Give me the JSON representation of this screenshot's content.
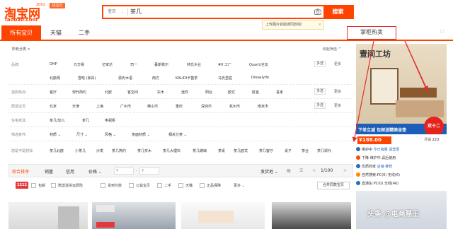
{
  "header": {
    "logo_cn": "淘宝网",
    "logo_en": "Taobao.com",
    "logo_ver": "2001",
    "logo_tag": "找宝贝",
    "search_scope": "宝贝",
    "search_query": "茶几",
    "search_button": "搜索",
    "tooltip": "上传图片就能搜同款啦!",
    "tooltip_close": "×"
  },
  "tabs": {
    "all": "所有宝贝",
    "tmall": "天猫",
    "used": "二手",
    "store": "掌柜热卖"
  },
  "filters": {
    "breadcrumb": "所有分类 >",
    "collapse": "收起筛选 ^",
    "multi_label": "多选",
    "more_label": "更多",
    "brand_label": "品牌:",
    "brand_row1": [
      "DHP",
      "元方缘",
      "亿家达",
      "司一",
      "蔓斯菲尔",
      "林氏木业",
      "#0 工厂",
      "QuanU全友"
    ],
    "brand_row2": [
      "北欧阁",
      "雪晗 (家具)",
      "源氏木语",
      "南方",
      "KALIDI卡笛茶",
      "马氏皇庭",
      "Dreaslyife"
    ],
    "hot_label": "选购热点:",
    "hot": [
      "客厅",
      "现代简约",
      "北欧",
      "客空间",
      "实木",
      "迷你",
      "阳台",
      "欧式",
      "卧室",
      "喜家"
    ],
    "ship_label": "配送宝贝:",
    "ship": [
      "北京",
      "天津",
      "上海",
      "广州市",
      "佛山市",
      "重庆",
      "深圳市",
      "杭州市",
      "南京市"
    ],
    "scene_label": "住宅家具:",
    "scene": [
      "茶几/幼儿",
      "茶几",
      "电视柜"
    ],
    "cond_label": "筛选条件:",
    "cond": [
      "材质",
      "尺寸",
      "风格",
      "茶面材质",
      "相关分类"
    ],
    "seek_label": "您是不是想找:",
    "seek": [
      "茶几北欧",
      "小茶几",
      "沙发",
      "茶几简约",
      "茶几实木",
      "茶几大理石",
      "茶几玻璃",
      "茶桌",
      "茶几欧式",
      "茶几客厅",
      "桌子",
      "茶台",
      "茶几现代"
    ]
  },
  "sortbar": {
    "default": "综合排序",
    "sales": "销量",
    "credit": "信用",
    "price": "价格",
    "price_from": "¥",
    "price_to": "¥",
    "ship_to": "发货地",
    "page": "1/100"
  },
  "options": {
    "badge": "1212",
    "items": [
      "包邮",
      "赠送退货运费险",
      "货到付款",
      "公益宝贝",
      "二手",
      "天猫",
      "正品保障"
    ],
    "more": "更多",
    "merge": "合并同款宝贝"
  },
  "ad": {
    "brand": "壹间工坊",
    "strip": "下单立减 包邮送精美坐垫",
    "circle": "双十二",
    "price": "¥188.00",
    "sold_label": "月销",
    "sold_value": "223",
    "line1_prefix": "维护中",
    "line1_link": "今日销量 请登录",
    "line2": "下降 维护中,请后使用",
    "line3_prefix": "优质商家",
    "line3_link": "店铺 推荐",
    "line4_prefix": "自然搜索:",
    "line4_value": "PC(0) 无线(6)",
    "line5_prefix": "直通车:",
    "line5_value": "PC(0) 无线(46)",
    "watermark": "头条 @电商易王"
  },
  "colors": {
    "brand": "#ff4400",
    "annotation": "#e03030"
  }
}
